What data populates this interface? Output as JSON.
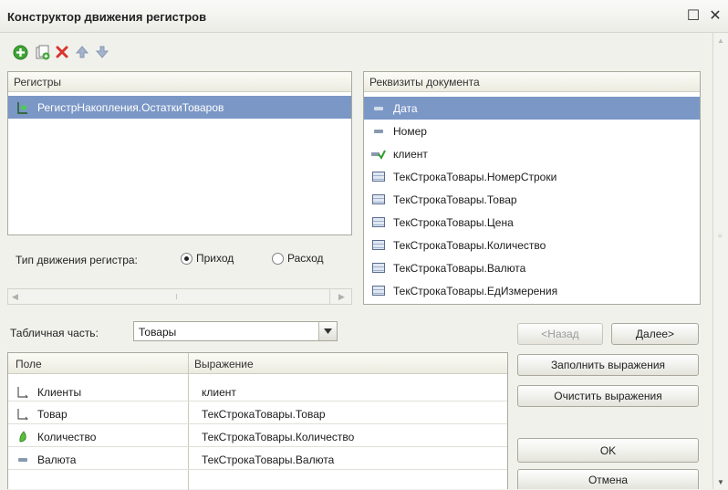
{
  "window": {
    "title": "Конструктор движения регистров",
    "maximize_glyph": "☐",
    "close_glyph": "✕"
  },
  "toolbar": {
    "icons": [
      "add-icon",
      "copy-icon",
      "delete-icon",
      "move-up-icon",
      "move-down-icon"
    ]
  },
  "registers": {
    "header": "Регистры",
    "items": [
      {
        "label": "РегистрНакопления.ОстаткиТоваров",
        "selected": true
      }
    ]
  },
  "movement_type": {
    "label": "Тип движения регистра:",
    "options": [
      {
        "label": "Приход",
        "selected": true
      },
      {
        "label": "Расход",
        "selected": false
      }
    ]
  },
  "doc_attributes": {
    "header": "Реквизиты документа",
    "items": [
      {
        "label": "Дата",
        "icon": "attribute-icon",
        "selected": true
      },
      {
        "label": "Номер",
        "icon": "attribute-icon"
      },
      {
        "label": "клиент",
        "icon": "attribute-check-icon"
      },
      {
        "label": "ТекСтрокаТовары.НомерСтроки",
        "icon": "table-attribute-icon"
      },
      {
        "label": "ТекСтрокаТовары.Товар",
        "icon": "table-attribute-icon"
      },
      {
        "label": "ТекСтрокаТовары.Цена",
        "icon": "table-attribute-icon"
      },
      {
        "label": "ТекСтрокаТовары.Количество",
        "icon": "table-attribute-icon"
      },
      {
        "label": "ТекСтрокаТовары.Валюта",
        "icon": "table-attribute-icon"
      },
      {
        "label": "ТекСтрокаТовары.ЕдИзмерения",
        "icon": "table-attribute-icon"
      }
    ]
  },
  "tabular_part": {
    "label": "Табличная часть:",
    "value": "Товары"
  },
  "fields_table": {
    "columns": [
      "Поле",
      "Выражение"
    ],
    "rows": [
      {
        "field": "Клиенты",
        "expression": "клиент",
        "icon": "dimension-icon"
      },
      {
        "field": "Товар",
        "expression": "ТекСтрокаТовары.Товар",
        "icon": "dimension-icon"
      },
      {
        "field": "Количество",
        "expression": "ТекСтрокаТовары.Количество",
        "icon": "resource-icon"
      },
      {
        "field": "Валюта",
        "expression": "ТекСтрокаТовары.Валюта",
        "icon": "attribute-icon"
      }
    ]
  },
  "buttons": {
    "back": "<Назад",
    "next": "Далее>",
    "fill": "Заполнить выражения",
    "clear": "Очистить выражения",
    "ok": "OK",
    "cancel": "Отмена"
  },
  "colors": {
    "selection": "#7b97c6",
    "add_green": "#3fa535",
    "delete_red": "#d9342b"
  }
}
